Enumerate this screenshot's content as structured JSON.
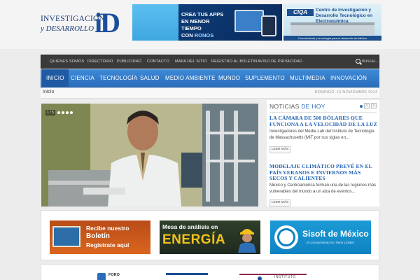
{
  "brand": {
    "line1": "INVESTIGACION",
    "line2": "y DESARROLLO",
    "mark": "iD"
  },
  "ads": {
    "apps_title": "CREA TUS APPS",
    "apps_line2": "EN MENOR TIEMPO",
    "apps_line3": "CON",
    "apps_brand": "RONOS",
    "center_logo": "CIQA",
    "center_title": "Centro de Investigación y Desarrollo Tecnológico en Electroquímica",
    "center_footer": "Conocimiento y tecnología para el desarrollo de México"
  },
  "topnav": {
    "items": [
      "QUIENES SOMOS",
      "DIRECTORIO",
      "PUBLICIDAD",
      "CONTACTO",
      "MAPA DEL SITIO",
      "REGISTRO AL BOLETÍN",
      "AVISO DE PRIVACIDAD"
    ],
    "search_placeholder": "Buscar..."
  },
  "mainnav": {
    "items": [
      "INICIO",
      "CIENCIA",
      "TECNOLOGÍA",
      "SALUD",
      "MEDIO AMBIENTE",
      "MUNDO",
      "SUPLEMENTO",
      "MULTIMEDIA",
      "INNOVACIÓN"
    ],
    "active_index": 0
  },
  "breadcrumb": {
    "current": "Inicio",
    "date": "DOMINGO, 16 NOVIEMBRE 2014"
  },
  "slider": {
    "page_label": "1 / 5",
    "dots_count": 4
  },
  "news": {
    "title_part1": "NOTICIAS",
    "title_part2": "DE HOY",
    "items": [
      {
        "headline": "LA CÁMARA DE 500 DÓLARES QUE FUNCIONA A LA VELOCIDAD DE LA LUZ",
        "summary": "Investigadores del Media Lab del Instituto de Tecnología de Massachusetts (MIT por sus siglas en...",
        "more": "LEER MÁS"
      },
      {
        "headline": "MODELAJE CLIMÁTICO PREVÉ EN EL PAÍS VERANOS E INVIERNOS MÁS SECOS Y CALIENTES",
        "summary": "México y Centroamérica forman una de las regiones más vulnerables del mundo a un alza de eventos...",
        "more": "LEER MÁS"
      }
    ]
  },
  "banners": {
    "boletin_line1": "Recibe nuestro",
    "boletin_line2": "Boletín",
    "boletin_line3": "Regístrate aquí",
    "energia_line1": "Mesa de análisis en",
    "energia_line2": "ENERGÍA",
    "sisoft_name": "Sisoft de México",
    "sisoft_tagline": "El Conocimiento No Tiene Límites"
  },
  "bottom": {
    "foro": "FORO",
    "instituto": "INSTITUTO"
  },
  "colors": {
    "nav_blue": "#2a6dbb",
    "topnav_dark": "#3a3a3a",
    "headline_blue": "#1d5fb0"
  }
}
